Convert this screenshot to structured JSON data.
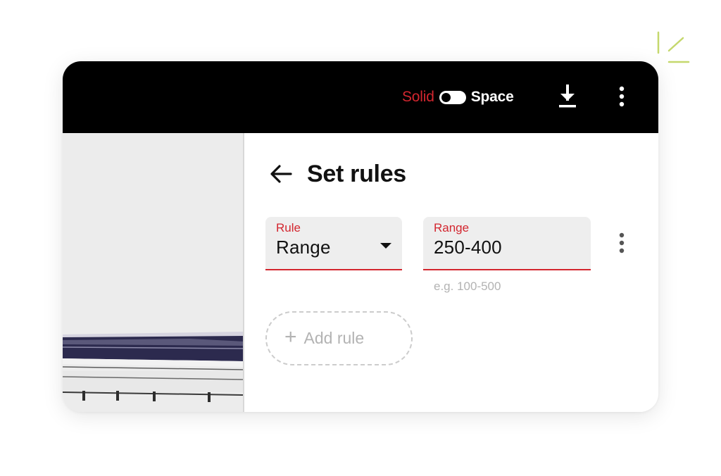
{
  "topbar": {
    "mode_left": "Solid",
    "mode_right": "Space",
    "download_icon": "download-icon",
    "menu_icon": "more-vertical-icon"
  },
  "panel": {
    "back_icon": "arrow-left-icon",
    "title": "Set rules"
  },
  "rule_row": {
    "rule_field": {
      "label": "Rule",
      "value": "Range"
    },
    "range_field": {
      "label": "Range",
      "value": "250-400",
      "hint": "e.g. 100-500"
    },
    "menu_icon": "more-vertical-icon"
  },
  "add_rule": {
    "icon": "plus",
    "label": "Add rule"
  },
  "colors": {
    "accent_red": "#d3262f",
    "topbar_bg": "#000000",
    "decor_green": "#c5d86d"
  }
}
